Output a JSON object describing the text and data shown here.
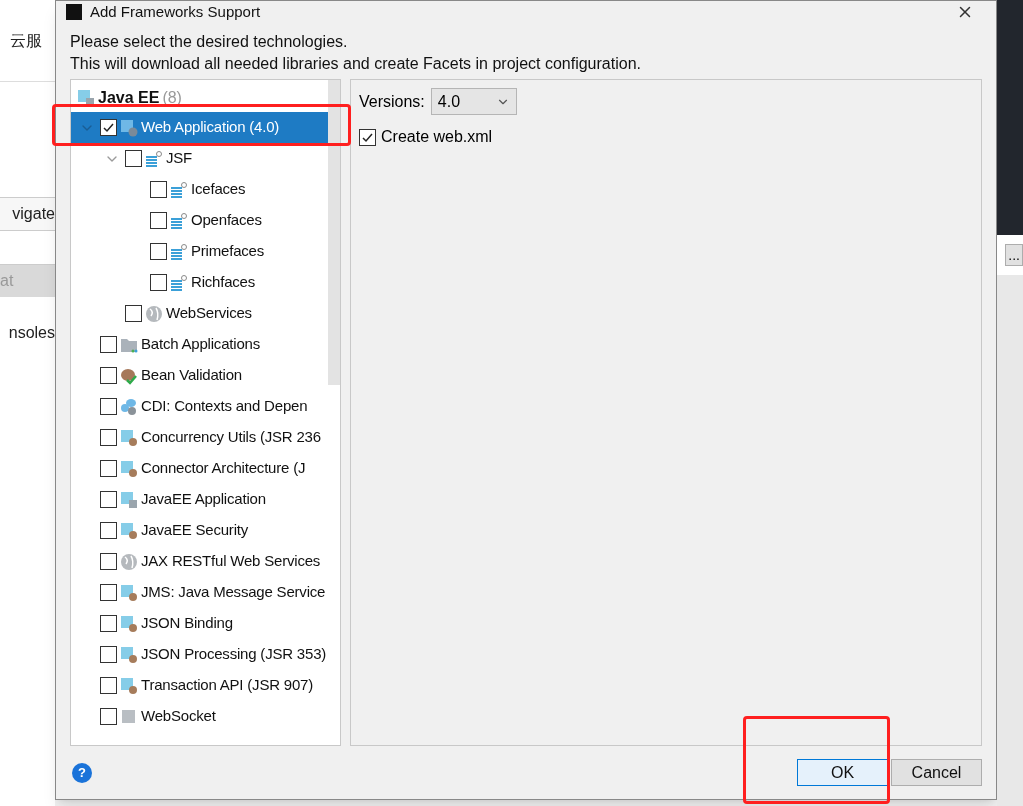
{
  "background": {
    "texts": [
      "云服",
      "vigate",
      "at",
      "nsoles"
    ],
    "button": "..."
  },
  "window": {
    "title": "Add Frameworks Support"
  },
  "description": [
    "Please select the desired technologies.",
    "This will download all needed libraries and create Facets in project configuration."
  ],
  "tree": {
    "label": "Java EE",
    "count": "(8)",
    "children": [
      {
        "label": "Web Application (4.0)",
        "kind": "module-web",
        "checked": true,
        "selected": true,
        "expanded": true,
        "children": [
          {
            "label": "JSF",
            "kind": "stack",
            "checked": false,
            "selected": false,
            "expanded": true,
            "children": [
              {
                "label": "Icefaces",
                "kind": "stack",
                "checked": false,
                "selected": false
              },
              {
                "label": "Openfaces",
                "kind": "stack",
                "checked": false,
                "selected": false
              },
              {
                "label": "Primefaces",
                "kind": "stack",
                "checked": false,
                "selected": false
              },
              {
                "label": "Richfaces",
                "kind": "stack",
                "checked": false,
                "selected": false
              }
            ]
          },
          {
            "label": "WebServices",
            "kind": "globe",
            "checked": false,
            "selected": false
          }
        ]
      },
      {
        "label": "Batch Applications",
        "kind": "folder",
        "checked": false,
        "selected": false
      },
      {
        "label": "Bean Validation",
        "kind": "bean",
        "checked": false,
        "selected": false
      },
      {
        "label": "CDI: Contexts and Depen",
        "kind": "cdi",
        "checked": false,
        "selected": false
      },
      {
        "label": "Concurrency Utils (JSR 236",
        "kind": "module",
        "checked": false,
        "selected": false
      },
      {
        "label": "Connector Architecture (J",
        "kind": "module",
        "checked": false,
        "selected": false
      },
      {
        "label": "JavaEE Application",
        "kind": "module-ee",
        "checked": false,
        "selected": false
      },
      {
        "label": "JavaEE Security",
        "kind": "module",
        "checked": false,
        "selected": false
      },
      {
        "label": "JAX RESTful Web Services",
        "kind": "globe",
        "checked": false,
        "selected": false
      },
      {
        "label": "JMS: Java Message Service",
        "kind": "module",
        "checked": false,
        "selected": false
      },
      {
        "label": "JSON Binding",
        "kind": "module",
        "checked": false,
        "selected": false
      },
      {
        "label": "JSON Processing (JSR 353)",
        "kind": "module",
        "checked": false,
        "selected": false
      },
      {
        "label": "Transaction API (JSR 907)",
        "kind": "module",
        "checked": false,
        "selected": false
      },
      {
        "label": "WebSocket",
        "kind": "plug",
        "checked": false,
        "selected": false
      }
    ]
  },
  "options": {
    "versions_label": "Versions:",
    "version": "4.0",
    "create_web_xml": {
      "label": "Create web.xml",
      "checked": true
    }
  },
  "help": "?",
  "buttons": [
    {
      "label": "OK",
      "default": true
    },
    {
      "label": "Cancel",
      "default": false
    }
  ]
}
